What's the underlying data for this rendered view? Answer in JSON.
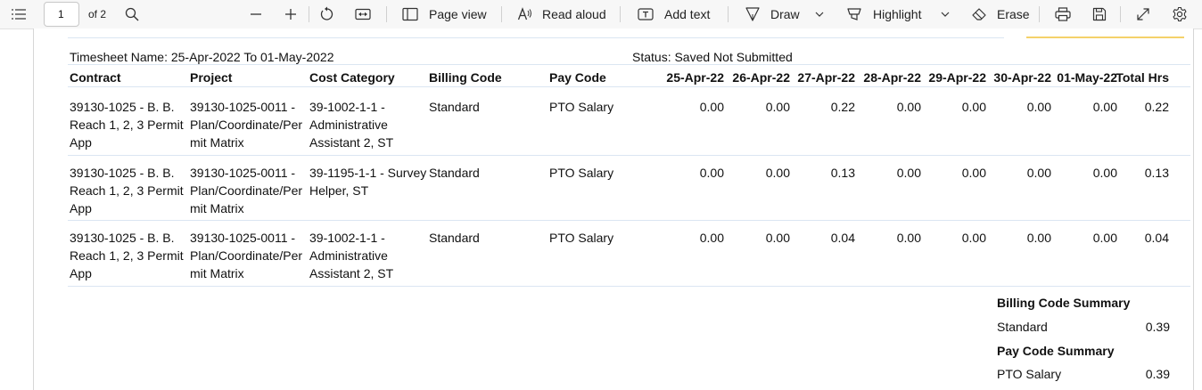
{
  "toolbar": {
    "page_number": "1",
    "page_count": "of 2",
    "page_view": "Page view",
    "read_aloud": "Read aloud",
    "add_text": "Add text",
    "draw": "Draw",
    "highlight": "Highlight",
    "erase": "Erase"
  },
  "document": {
    "timesheet_name": "Timesheet Name: 25-Apr-2022 To 01-May-2022",
    "status": "Status: Saved Not Submitted",
    "headers": [
      "Contract",
      "Project",
      "Cost Category",
      "Billing Code",
      "Pay Code",
      "25-Apr-22",
      "26-Apr-22",
      "27-Apr-22",
      "28-Apr-22",
      "29-Apr-22",
      "30-Apr-22",
      "01-May-22",
      "Total Hrs"
    ],
    "rows": [
      {
        "contract": [
          "39130-1025  - B. B.",
          "Reach 1, 2, 3 Permit",
          "App"
        ],
        "project": [
          "39130-1025-0011 -",
          "Plan/Coordinate/Per",
          "mit Matrix"
        ],
        "cost_category": [
          "39-1002-1-1 -",
          "Administrative",
          "Assistant 2, ST"
        ],
        "billing_code": "Standard",
        "pay_code": "PTO Salary",
        "days": [
          "0.00",
          "0.00",
          "0.22",
          "0.00",
          "0.00",
          "0.00",
          "0.00"
        ],
        "total": "0.22"
      },
      {
        "contract": [
          "39130-1025  - B. B.",
          "Reach 1, 2, 3 Permit",
          "App"
        ],
        "project": [
          "39130-1025-0011 -",
          "Plan/Coordinate/Per",
          "mit Matrix"
        ],
        "cost_category": [
          "39-1195-1-1 - Survey",
          "Helper, ST"
        ],
        "billing_code": "Standard",
        "pay_code": "PTO Salary",
        "days": [
          "0.00",
          "0.00",
          "0.13",
          "0.00",
          "0.00",
          "0.00",
          "0.00"
        ],
        "total": "0.13"
      },
      {
        "contract": [
          "39130-1025  - B. B.",
          "Reach 1, 2, 3 Permit",
          "App"
        ],
        "project": [
          "39130-1025-0011 -",
          "Plan/Coordinate/Per",
          "mit Matrix"
        ],
        "cost_category": [
          "39-1002-1-1 -",
          "Administrative",
          "Assistant 2, ST"
        ],
        "billing_code": "Standard",
        "pay_code": "PTO Salary",
        "days": [
          "0.00",
          "0.00",
          "0.04",
          "0.00",
          "0.00",
          "0.00",
          "0.00"
        ],
        "total": "0.04"
      }
    ],
    "billing_summary": {
      "title": "Billing Code Summary",
      "label": "Standard",
      "value": "0.39"
    },
    "pay_summary": {
      "title": "Pay Code Summary",
      "label": "PTO Salary",
      "value": "0.39"
    }
  },
  "colors": {
    "rule": "#dbe6f2",
    "highlight_bar": "#f4d26a"
  }
}
